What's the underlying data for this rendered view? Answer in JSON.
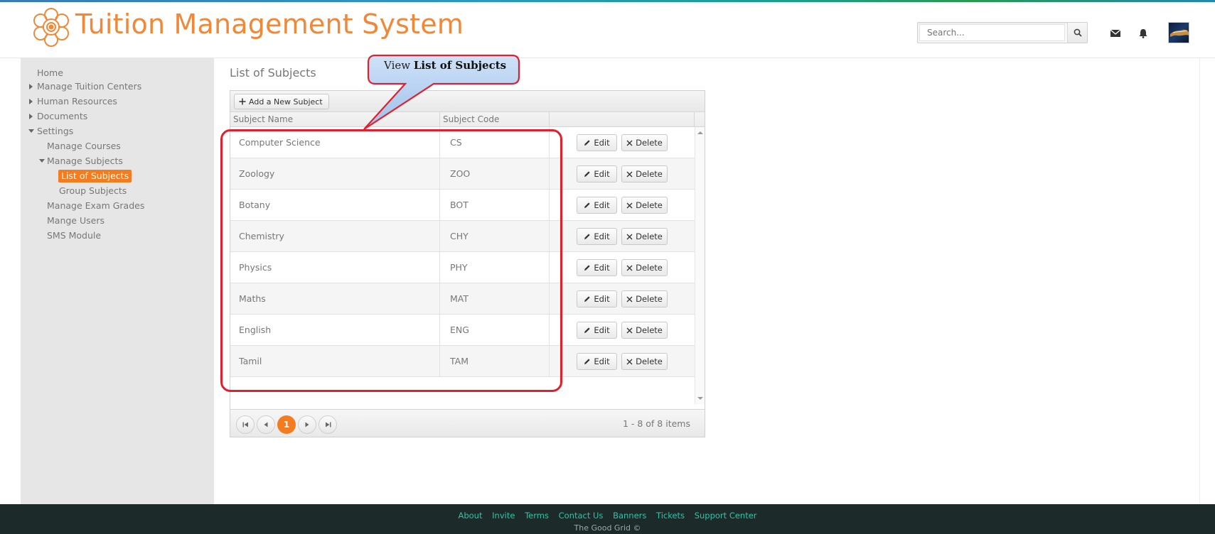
{
  "header": {
    "title": "Tuition Management System",
    "search_placeholder": "Search..."
  },
  "sidebar": {
    "items": [
      {
        "label": "Home",
        "level": 0,
        "expander": "none"
      },
      {
        "label": "Manage Tuition Centers",
        "level": 0,
        "expander": "collapsed"
      },
      {
        "label": "Human Resources",
        "level": 0,
        "expander": "collapsed"
      },
      {
        "label": "Documents",
        "level": 0,
        "expander": "collapsed"
      },
      {
        "label": "Settings",
        "level": 0,
        "expander": "expanded"
      },
      {
        "label": "Manage Courses",
        "level": 1,
        "expander": "none"
      },
      {
        "label": "Manage Subjects",
        "level": 1,
        "expander": "expanded"
      },
      {
        "label": "List of Subjects",
        "level": 2,
        "expander": "none",
        "active": true
      },
      {
        "label": "Group Subjects",
        "level": 2,
        "expander": "none"
      },
      {
        "label": "Manage Exam Grades",
        "level": 1,
        "expander": "none"
      },
      {
        "label": "Mange Users",
        "level": 1,
        "expander": "none"
      },
      {
        "label": "SMS Module",
        "level": 1,
        "expander": "none"
      }
    ]
  },
  "main": {
    "page_title": "List of Subjects",
    "add_button": "Add a New Subject",
    "columns": [
      "Subject Name",
      "Subject Code"
    ],
    "rows": [
      {
        "name": "Computer Science",
        "code": "CS"
      },
      {
        "name": "Zoology",
        "code": "ZOO"
      },
      {
        "name": "Botany",
        "code": "BOT"
      },
      {
        "name": "Chemistry",
        "code": "CHY"
      },
      {
        "name": "Physics",
        "code": "PHY"
      },
      {
        "name": "Maths",
        "code": "MAT"
      },
      {
        "name": "English",
        "code": "ENG"
      },
      {
        "name": "Tamil",
        "code": "TAM"
      }
    ],
    "edit_label": "Edit",
    "delete_label": "Delete",
    "pager": {
      "current_page": "1",
      "info": "1 - 8 of 8 items"
    }
  },
  "callout": {
    "prefix": "View",
    "bold": "List of Subjects"
  },
  "footer": {
    "links": [
      "About",
      "Invite",
      "Terms",
      "Contact Us",
      "Banners",
      "Tickets",
      "Support Center"
    ],
    "copyright": "The Good Grid ©"
  },
  "colors": {
    "accent": "#f47c20",
    "title": "#f0883a",
    "footer_bg": "#1d2a2a",
    "footer_link": "#2ec4a6",
    "callout_border": "#e0202e",
    "callout_fill": "#a9c9ee"
  }
}
